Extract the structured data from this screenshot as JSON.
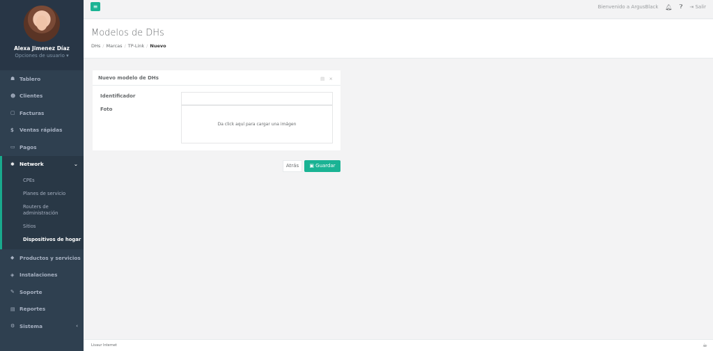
{
  "user": {
    "name": "Alexa Jimenez Díaz",
    "options": "Opciones de usuario ▾"
  },
  "sidebar": {
    "items_top": [
      {
        "icon": "☗",
        "label": "Tablero"
      },
      {
        "icon": "☻",
        "label": "Clientes"
      },
      {
        "icon": "▢",
        "label": "Facturas"
      },
      {
        "icon": "$",
        "label": "Ventas rápidas"
      },
      {
        "icon": "▭",
        "label": "Pagos"
      }
    ],
    "active": {
      "icon": "✱",
      "label": "Network",
      "chevron": "⌄"
    },
    "subitems": [
      "CPEs",
      "Planes de servicio",
      "Routers de administración",
      "Sitios",
      "Dispositivos de hogar"
    ],
    "items_bottom": [
      {
        "icon": "◆",
        "label": "Productos y servicios"
      },
      {
        "icon": "◈",
        "label": "Instalaciones"
      },
      {
        "icon": "✎",
        "label": "Soporte"
      },
      {
        "icon": "▤",
        "label": "Reportes"
      },
      {
        "icon": "⚙",
        "label": "Sistema",
        "chevron": "‹"
      }
    ]
  },
  "topbar": {
    "toggle": "≡",
    "welcome": "Bienvenido a ArgusBlack",
    "logout": "Salir"
  },
  "heading": {
    "title": "Modelos de DHs",
    "breadcrumb": [
      "DHs",
      "Marcas",
      "TP-Link",
      "Nuevo"
    ]
  },
  "card": {
    "title": "Nuevo modelo de DHs",
    "tools": "▤ ×",
    "identifier_label": "Identificador",
    "identifier_value": "",
    "photo_label": "Foto",
    "dropzone_text": "Da click aquí para cargar una imágen"
  },
  "actions": {
    "back": "Atrás",
    "save": "Guardar",
    "save_icon": "💾"
  },
  "footer": {
    "text": "Livaur Internet",
    "icon": "☕"
  }
}
